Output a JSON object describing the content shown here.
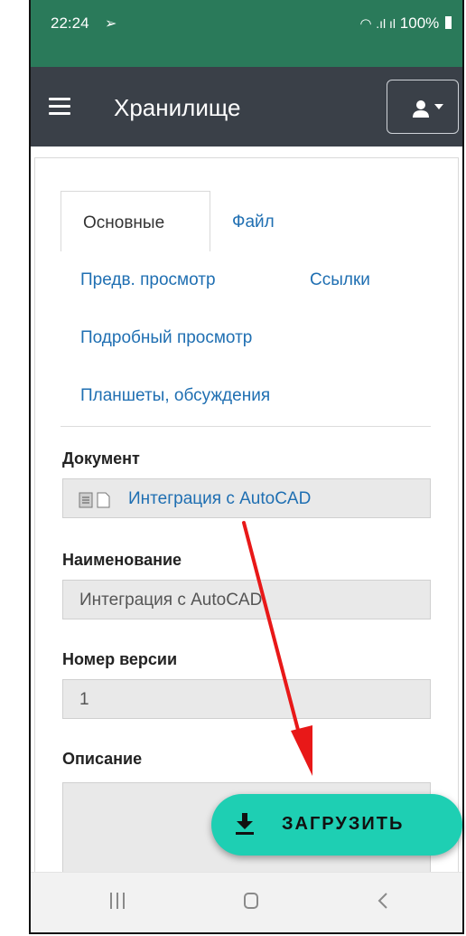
{
  "status_bar": {
    "time": "22:24",
    "battery": "100%"
  },
  "app_bar": {
    "title": "Хранилище"
  },
  "tabs": {
    "active": "Основные",
    "file": "Файл",
    "preview": "Предв. просмотр",
    "links": "Ссылки",
    "detailed": "Подробный просмотр",
    "boards": "Планшеты, обсуждения"
  },
  "form": {
    "document_label": "Документ",
    "document_value": "Интеграция с AutoCAD",
    "name_label": "Наименование",
    "name_value": "Интеграция с AutoCAD",
    "version_label": "Номер версии",
    "version_value": "1",
    "description_label": "Описание"
  },
  "fab": {
    "label": "ЗАГРУЗИТЬ"
  },
  "colors": {
    "status": "#2a7a5a",
    "appbar": "#3a4048",
    "link": "#1f6fb2",
    "fab": "#1ecfb3",
    "annotation_arrow": "#e81818"
  },
  "icons": [
    "menu-icon",
    "user-icon",
    "download-icon",
    "document-icon",
    "file-icon",
    "recent-apps-icon",
    "home-icon",
    "back-icon",
    "wifi-icon",
    "signal-icon",
    "battery-icon"
  ]
}
